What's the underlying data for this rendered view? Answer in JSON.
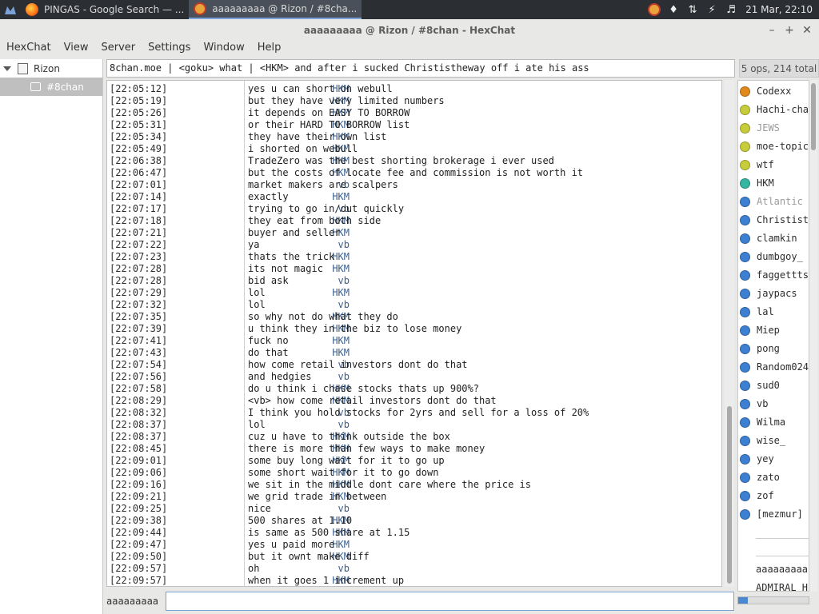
{
  "panel": {
    "tasks": [
      {
        "label": "PINGAS - Google Search — ...",
        "icon": "firefox-icon"
      },
      {
        "label": "aaaaaaaaa @ Rizon / #8cha...",
        "icon": "hexchat-icon"
      }
    ],
    "clock": "21 Mar, 22:10"
  },
  "window": {
    "title": "aaaaaaaaa @ Rizon / #8chan - HexChat"
  },
  "menubar": {
    "items": [
      "HexChat",
      "View",
      "Server",
      "Settings",
      "Window",
      "Help"
    ]
  },
  "tree": {
    "server": "Rizon",
    "channel": "#8chan"
  },
  "topic": "8chan.moe | <goku> what | <HKM> and after i sucked Christistheway off i ate his ass",
  "ops_count": "5 ops, 214 total",
  "messages": [
    {
      "time": "[22:05:12]",
      "nick": "HKM",
      "text": "yes u can short on webull"
    },
    {
      "time": "[22:05:19]",
      "nick": "HKM",
      "text": "but they have very limited numbers"
    },
    {
      "time": "[22:05:26]",
      "nick": "HKM",
      "text": "it depends on EASY TO BORROW"
    },
    {
      "time": "[22:05:31]",
      "nick": "HKM",
      "text": "or their HARD TO BORROW list"
    },
    {
      "time": "[22:05:34]",
      "nick": "HKM",
      "text": "they have their own list"
    },
    {
      "time": "[22:05:49]",
      "nick": "HKM",
      "text": "i shorted on webull"
    },
    {
      "time": "[22:06:38]",
      "nick": "HKM",
      "text": "TradeZero was the best shorting brokerage i ever used"
    },
    {
      "time": "[22:06:47]",
      "nick": "HKM",
      "text": "but the costs of locate fee and commission is not worth it"
    },
    {
      "time": "[22:07:01]",
      "nick": "vb",
      "text": "market makers are scalpers"
    },
    {
      "time": "[22:07:14]",
      "nick": "HKM",
      "text": "exactly"
    },
    {
      "time": "[22:07:17]",
      "nick": "vb",
      "text": "trying to go in/out quickly"
    },
    {
      "time": "[22:07:18]",
      "nick": "HKM",
      "text": "they eat from both side"
    },
    {
      "time": "[22:07:21]",
      "nick": "HKM",
      "text": "buyer and seller"
    },
    {
      "time": "[22:07:22]",
      "nick": "vb",
      "text": "ya"
    },
    {
      "time": "[22:07:23]",
      "nick": "HKM",
      "text": "thats the trick"
    },
    {
      "time": "[22:07:28]",
      "nick": "HKM",
      "text": "its not magic"
    },
    {
      "time": "[22:07:28]",
      "nick": "vb",
      "text": "bid ask"
    },
    {
      "time": "[22:07:29]",
      "nick": "HKM",
      "text": "lol"
    },
    {
      "time": "[22:07:32]",
      "nick": "vb",
      "text": "lol"
    },
    {
      "time": "[22:07:35]",
      "nick": "HKM",
      "text": "so why not do what they do"
    },
    {
      "time": "[22:07:39]",
      "nick": "HKM",
      "text": "u think they in the biz to lose money"
    },
    {
      "time": "[22:07:41]",
      "nick": "HKM",
      "text": "fuck no"
    },
    {
      "time": "[22:07:43]",
      "nick": "HKM",
      "text": "do that"
    },
    {
      "time": "[22:07:54]",
      "nick": "vb",
      "text": "how come retail investors dont do that"
    },
    {
      "time": "[22:07:56]",
      "nick": "vb",
      "text": "and hedgies"
    },
    {
      "time": "[22:07:58]",
      "nick": "HKM",
      "text": "do u think i chase stocks thats up 900%?"
    },
    {
      "time": "[22:08:29]",
      "nick": "HKM",
      "text": "<vb> how come retail investors dont do that"
    },
    {
      "time": "[22:08:32]",
      "nick": "vb",
      "text": "I think you hold stocks for 2yrs and sell for a loss of 20%"
    },
    {
      "time": "[22:08:37]",
      "nick": "vb",
      "text": "lol"
    },
    {
      "time": "[22:08:37]",
      "nick": "HKM",
      "text": "cuz u have to think outside the box"
    },
    {
      "time": "[22:08:45]",
      "nick": "HKM",
      "text": "there is more than few ways to make money"
    },
    {
      "time": "[22:09:01]",
      "nick": "HKM",
      "text": "some buy long wait for it to go up"
    },
    {
      "time": "[22:09:06]",
      "nick": "HKM",
      "text": "some short wait for it to go down"
    },
    {
      "time": "[22:09:16]",
      "nick": "HKM",
      "text": "we sit in the middle dont care where the price is"
    },
    {
      "time": "[22:09:21]",
      "nick": "HKM",
      "text": "we grid trade in between"
    },
    {
      "time": "[22:09:25]",
      "nick": "vb",
      "text": "nice"
    },
    {
      "time": "[22:09:38]",
      "nick": "HKM",
      "text": "500 shares at 1.10"
    },
    {
      "time": "[22:09:44]",
      "nick": "HKM",
      "text": "is same as 500 share at 1.15"
    },
    {
      "time": "[22:09:47]",
      "nick": "HKM",
      "text": "yes u paid more"
    },
    {
      "time": "[22:09:50]",
      "nick": "HKM",
      "text": "but it ownt make diff"
    },
    {
      "time": "[22:09:57]",
      "nick": "vb",
      "text": "oh"
    },
    {
      "time": "[22:09:57]",
      "nick": "HKM",
      "text": "when it goes 1 increment up"
    }
  ],
  "users": [
    {
      "name": "Codexx",
      "color": "#e08a1e",
      "muted": false
    },
    {
      "name": "Hachi-cha",
      "color": "#c6cc3a",
      "muted": false
    },
    {
      "name": "JEWS",
      "color": "#c6cc3a",
      "muted": true
    },
    {
      "name": "moe-topic",
      "color": "#c6cc3a",
      "muted": false
    },
    {
      "name": "wtf",
      "color": "#c6cc3a",
      "muted": false
    },
    {
      "name": "HKM",
      "color": "#35b5a2",
      "muted": false
    },
    {
      "name": "Atlantic",
      "color": "#3d7fd1",
      "muted": true
    },
    {
      "name": "Christist",
      "color": "#3d7fd1",
      "muted": false
    },
    {
      "name": "clamkin",
      "color": "#3d7fd1",
      "muted": false
    },
    {
      "name": "dumbgoy_",
      "color": "#3d7fd1",
      "muted": false
    },
    {
      "name": "faggettts",
      "color": "#3d7fd1",
      "muted": false
    },
    {
      "name": "jaypacs",
      "color": "#3d7fd1",
      "muted": false
    },
    {
      "name": "lal",
      "color": "#3d7fd1",
      "muted": false
    },
    {
      "name": "Miep",
      "color": "#3d7fd1",
      "muted": false
    },
    {
      "name": "pong",
      "color": "#3d7fd1",
      "muted": false
    },
    {
      "name": "Random024",
      "color": "#3d7fd1",
      "muted": false
    },
    {
      "name": "sud0",
      "color": "#3d7fd1",
      "muted": false
    },
    {
      "name": "vb",
      "color": "#3d7fd1",
      "muted": false
    },
    {
      "name": "Wilma",
      "color": "#3d7fd1",
      "muted": false
    },
    {
      "name": "wise_",
      "color": "#3d7fd1",
      "muted": false
    },
    {
      "name": "yey",
      "color": "#3d7fd1",
      "muted": false
    },
    {
      "name": "zato",
      "color": "#3d7fd1",
      "muted": false
    },
    {
      "name": "zof",
      "color": "#3d7fd1",
      "muted": false
    },
    {
      "name": "[mezmur]",
      "color": "#3d7fd1",
      "muted": false
    }
  ],
  "users_more": [
    "aaaaaaaaa",
    "ADMIRAL_H"
  ],
  "input": {
    "nick": "aaaaaaaaa",
    "value": ""
  },
  "colors": {
    "nick": "#3b5e8c",
    "panel": "#2b2e33",
    "accent": "#7aa2d6"
  }
}
